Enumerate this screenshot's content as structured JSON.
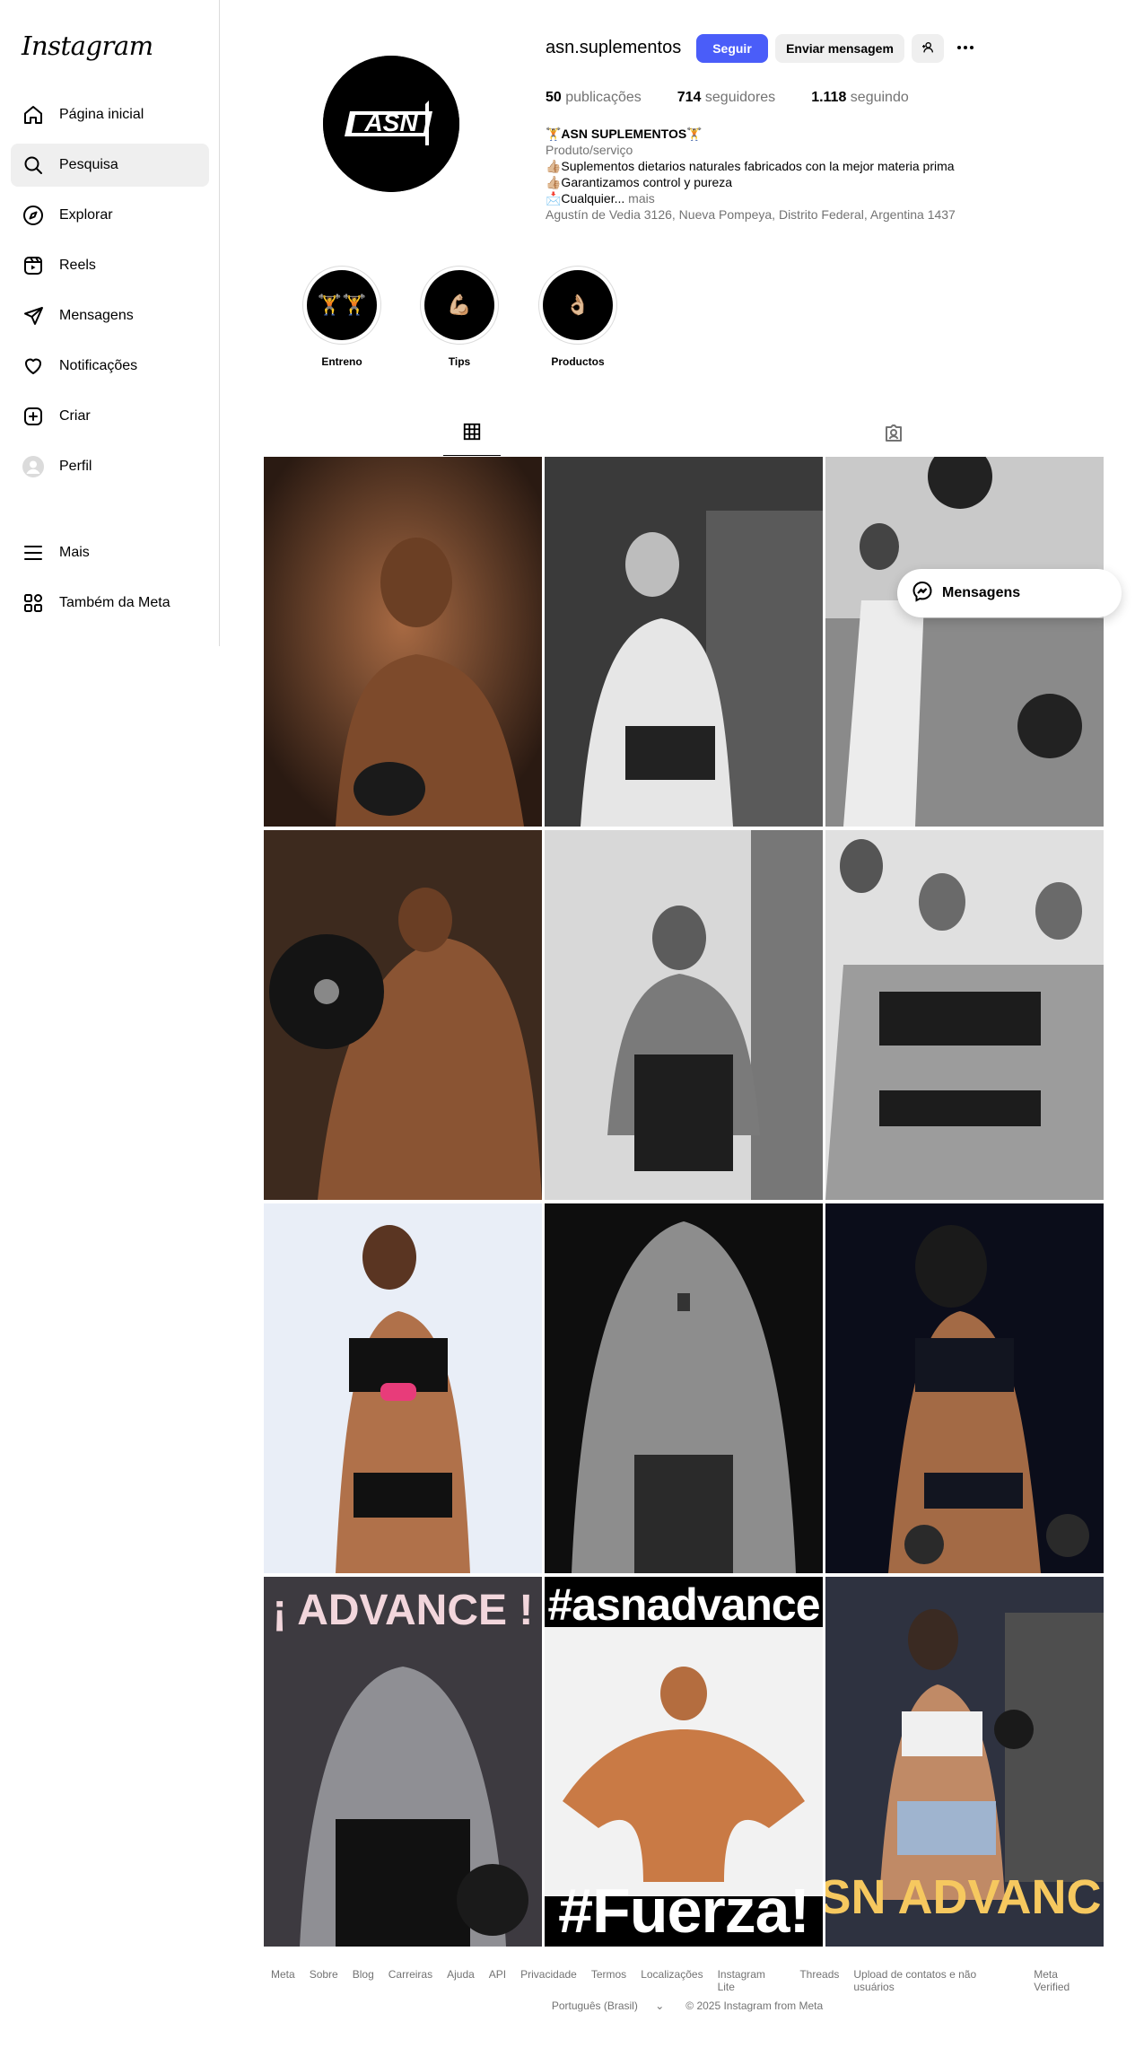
{
  "app": {
    "logo_text": "Instagram"
  },
  "sidebar": {
    "items": [
      {
        "label": "Página inicial",
        "icon": "home-icon"
      },
      {
        "label": "Pesquisa",
        "icon": "search-icon",
        "active": true
      },
      {
        "label": "Explorar",
        "icon": "compass-icon"
      },
      {
        "label": "Reels",
        "icon": "reels-icon"
      },
      {
        "label": "Mensagens",
        "icon": "send-icon"
      },
      {
        "label": "Notificações",
        "icon": "heart-icon"
      },
      {
        "label": "Criar",
        "icon": "plus-square-icon"
      },
      {
        "label": "Perfil",
        "icon": "avatar-icon"
      },
      {
        "label": "Mais",
        "icon": "menu-icon"
      },
      {
        "label": "Também da Meta",
        "icon": "meta-apps-icon"
      }
    ]
  },
  "profile": {
    "username": "asn.suplementos",
    "avatar_text": "ASN",
    "follow_label": "Seguir",
    "message_label": "Enviar mensagem",
    "stats": {
      "posts_count": "50",
      "posts_label": "publicações",
      "followers_count": "714",
      "followers_label": "seguidores",
      "following_count": "1.118",
      "following_label": "seguindo"
    },
    "bio": {
      "name": "🏋️ASN SUPLEMENTOS🏋️",
      "category": "Produto/serviço",
      "line1": "👍🏼Suplementos dietarios naturales fabricados con la mejor materia prima",
      "line2": "👍🏼Garantizamos control y pureza",
      "line3": "📩Cualquier...",
      "more": " mais",
      "address": "Agustín de Vedia 3126, Nueva Pompeya, Distrito Federal, Argentina 1437"
    }
  },
  "highlights": [
    {
      "label": "Entreno",
      "emoji": "🏋️🏋️"
    },
    {
      "label": "Tips",
      "emoji": "💪🏼"
    },
    {
      "label": "Productos",
      "emoji": "👌🏼"
    }
  ],
  "tabs": [
    {
      "icon": "grid-icon",
      "active": true
    },
    {
      "icon": "tagged-icon",
      "active": false
    }
  ],
  "posts": [
    {
      "text": ""
    },
    {
      "text": ""
    },
    {
      "text": ""
    },
    {
      "text": ""
    },
    {
      "text": ""
    },
    {
      "text": ""
    },
    {
      "text": ""
    },
    {
      "text": ""
    },
    {
      "text": ""
    },
    {
      "text": "¡ ADVANCE !"
    },
    {
      "text_top": "#asnadvance",
      "text_bottom": "#Fuerza!"
    },
    {
      "text": "SN ADVANC"
    }
  ],
  "floating_messages": {
    "label": "Mensagens"
  },
  "footer": {
    "links": [
      "Meta",
      "Sobre",
      "Blog",
      "Carreiras",
      "Ajuda",
      "API",
      "Privacidade",
      "Termos",
      "Localizações",
      "Instagram Lite",
      "Threads",
      "Upload de contatos e não usuários",
      "Meta Verified"
    ],
    "language": "Português (Brasil)",
    "copyright": "© 2025 Instagram from Meta"
  },
  "colors": {
    "accent": "#4a5df9",
    "secondary_text": "#737373",
    "border": "#dbdbdb",
    "active_bg": "#efefef"
  }
}
